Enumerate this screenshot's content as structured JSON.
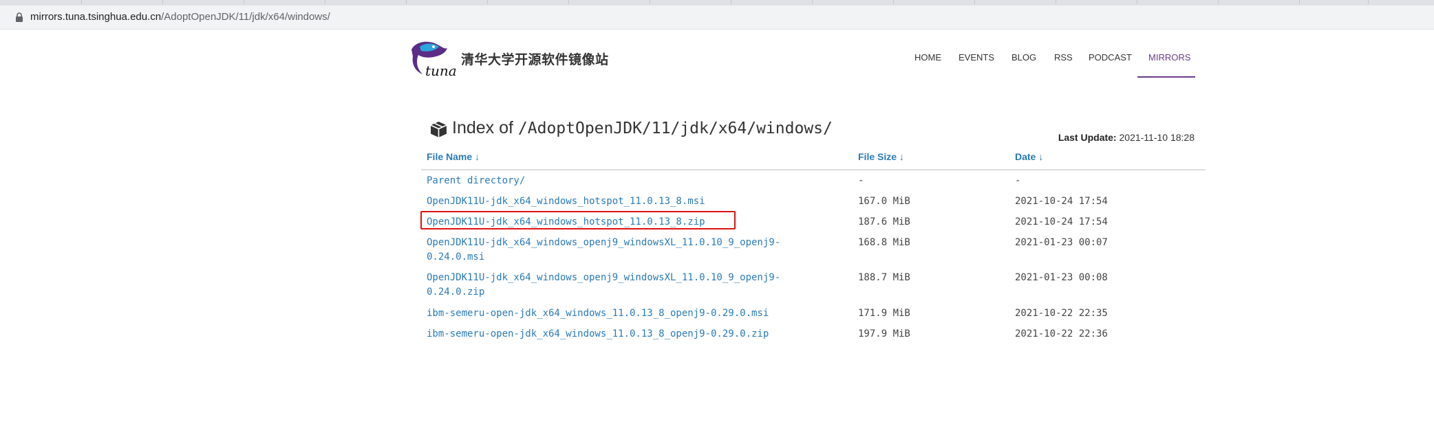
{
  "browser": {
    "url_host": "mirrors.tuna.tsinghua.edu.cn",
    "url_path": "/AdoptOpenJDK/11/jdk/x64/windows/",
    "lock_icon": "lock-icon"
  },
  "site": {
    "logo_text": "tuna",
    "title": "清华大学开源软件镜像站",
    "nav": [
      {
        "label": "HOME"
      },
      {
        "label": "EVENTS"
      },
      {
        "label": "BLOG"
      },
      {
        "label": "RSS"
      },
      {
        "label": "PODCAST"
      },
      {
        "label": "MIRRORS",
        "active": true
      }
    ],
    "accent_color": "#6a3a8c",
    "link_color": "#2a7ab8"
  },
  "index": {
    "icon": "box-icon",
    "label": "Index of",
    "directory": "/AdoptOpenJDK/11/jdk/x64/windows/",
    "last_update_label": "Last Update:",
    "last_update_value": "2021-11-10 18:28"
  },
  "table": {
    "headers": {
      "name": "File Name ↓",
      "size": "File Size ↓",
      "date": "Date ↓"
    },
    "rows": [
      {
        "name": "Parent directory/",
        "size": "-",
        "date": "-"
      },
      {
        "name": "OpenJDK11U-jdk_x64_windows_hotspot_11.0.13_8.msi",
        "size": "167.0 MiB",
        "date": "2021-10-24 17:54"
      },
      {
        "name": "OpenJDK11U-jdk_x64_windows_hotspot_11.0.13_8.zip",
        "size": "187.6 MiB",
        "date": "2021-10-24 17:54",
        "highlighted": true
      },
      {
        "name_line1": "OpenJDK11U-jdk_x64_windows_openj9_windowsXL_11.0.10_9_openj9-",
        "name_line2": "0.24.0.msi",
        "size": "168.8 MiB",
        "date": "2021-01-23 00:07"
      },
      {
        "name_line1": "OpenJDK11U-jdk_x64_windows_openj9_windowsXL_11.0.10_9_openj9-",
        "name_line2": "0.24.0.zip",
        "size": "188.7 MiB",
        "date": "2021-01-23 00:08"
      },
      {
        "name": "ibm-semeru-open-jdk_x64_windows_11.0.13_8_openj9-0.29.0.msi",
        "size": "171.9 MiB",
        "date": "2021-10-22 22:35"
      },
      {
        "name": "ibm-semeru-open-jdk_x64_windows_11.0.13_8_openj9-0.29.0.zip",
        "size": "197.9 MiB",
        "date": "2021-10-22 22:36"
      }
    ],
    "highlight_color": "#e01010"
  }
}
